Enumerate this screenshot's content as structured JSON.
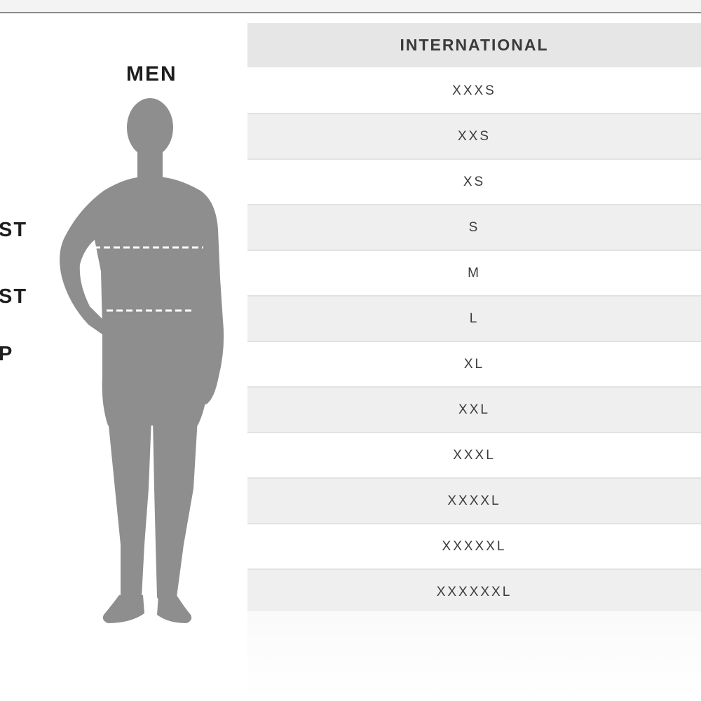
{
  "left": {
    "title": "MEN",
    "labels": {
      "chest": "ST",
      "waist": "ST",
      "hip": "P"
    },
    "figure_color": "#8e8e8e"
  },
  "table": {
    "header": "INTERNATIONAL",
    "rows": [
      "XXXS",
      "XXS",
      "XS",
      "S",
      "M",
      "L",
      "XL",
      "XXL",
      "XXXL",
      "XXXXL",
      "XXXXXL",
      "XXXXXXL"
    ]
  }
}
